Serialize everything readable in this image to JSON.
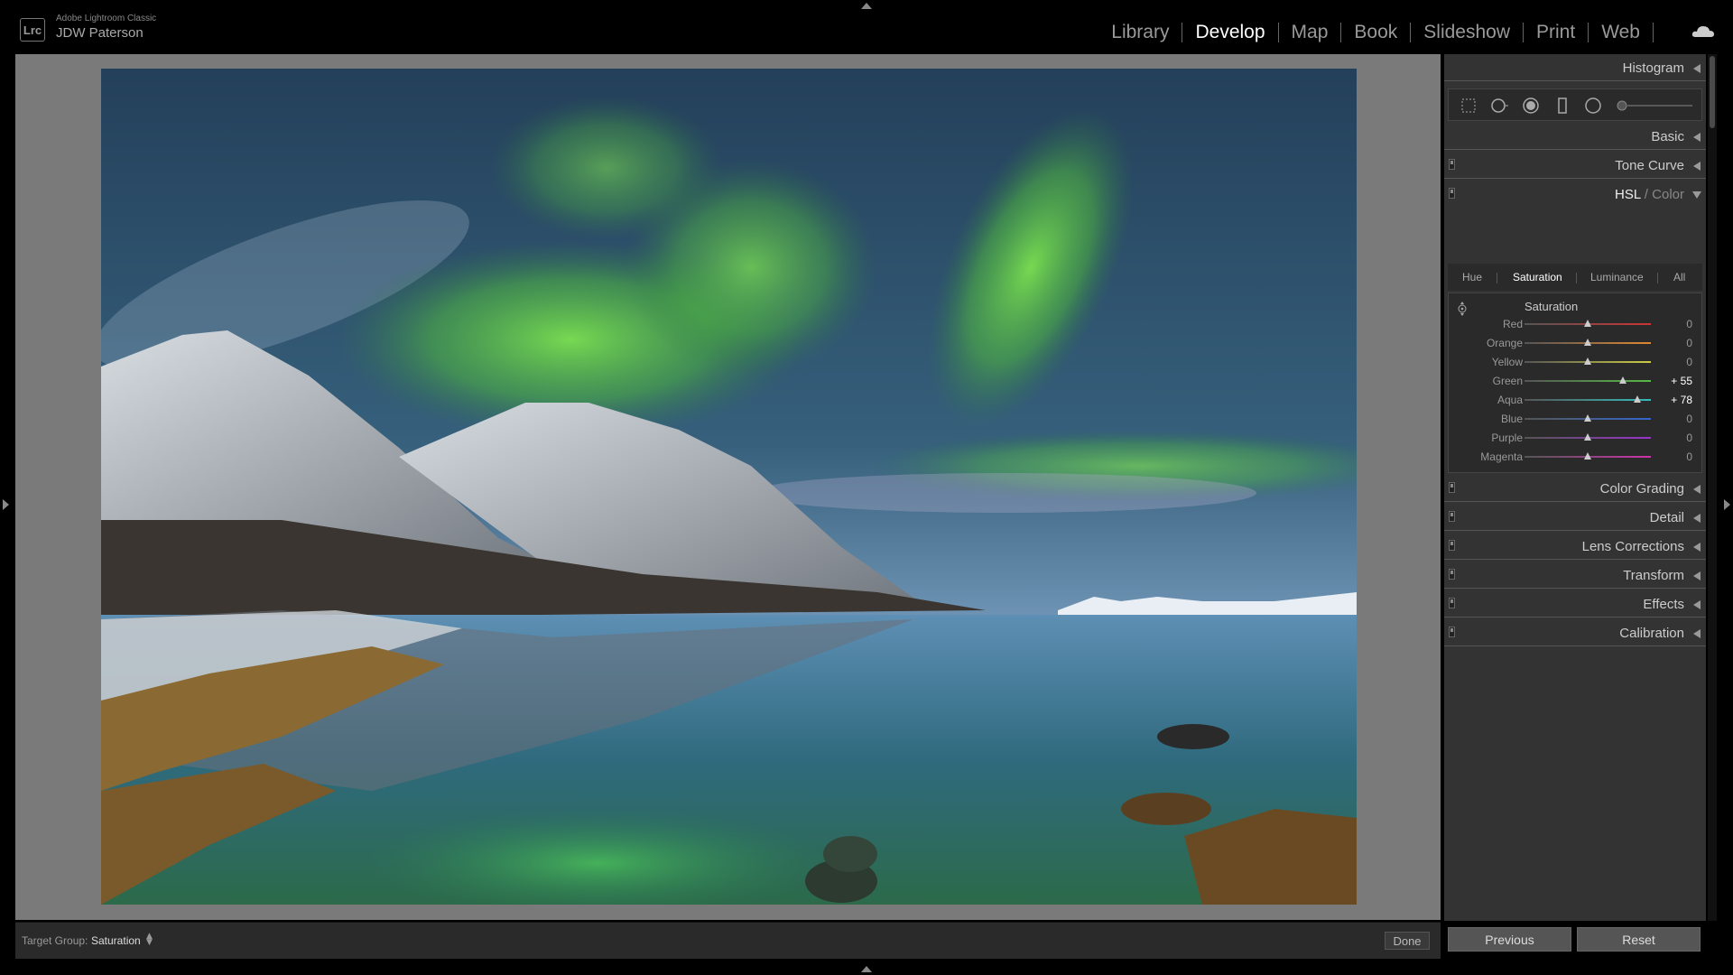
{
  "app": {
    "logo_text": "Lrc",
    "product": "Adobe Lightroom Classic",
    "user": "JDW Paterson"
  },
  "modules": [
    "Library",
    "Develop",
    "Map",
    "Book",
    "Slideshow",
    "Print",
    "Web"
  ],
  "active_module": "Develop",
  "toolbar": {
    "target_group_label": "Target Group:",
    "target_group_value": "Saturation",
    "done_label": "Done"
  },
  "panels": {
    "histogram": "Histogram",
    "basic": "Basic",
    "tone_curve": "Tone Curve",
    "hsl_main": "HSL",
    "hsl_sep": " / ",
    "hsl_alt": "Color",
    "color_grading": "Color Grading",
    "detail": "Detail",
    "lens_corrections": "Lens Corrections",
    "transform": "Transform",
    "effects": "Effects",
    "calibration": "Calibration"
  },
  "hsl": {
    "tabs": [
      "Hue",
      "Saturation",
      "Luminance",
      "All"
    ],
    "active_tab": "Saturation",
    "section_title": "Saturation",
    "sliders": [
      {
        "label": "Red",
        "value": "0",
        "num": 0,
        "color": "#c33"
      },
      {
        "label": "Orange",
        "value": "0",
        "num": 0,
        "color": "#d83"
      },
      {
        "label": "Yellow",
        "value": "0",
        "num": 0,
        "color": "#cc4"
      },
      {
        "label": "Green",
        "value": "+ 55",
        "num": 55,
        "color": "#5b4"
      },
      {
        "label": "Aqua",
        "value": "+ 78",
        "num": 78,
        "color": "#3bb"
      },
      {
        "label": "Blue",
        "value": "0",
        "num": 0,
        "color": "#36c"
      },
      {
        "label": "Purple",
        "value": "0",
        "num": 0,
        "color": "#93c"
      },
      {
        "label": "Magenta",
        "value": "0",
        "num": 0,
        "color": "#c3a"
      }
    ]
  },
  "footer": {
    "previous_label": "Previous",
    "reset_label": "Reset"
  }
}
